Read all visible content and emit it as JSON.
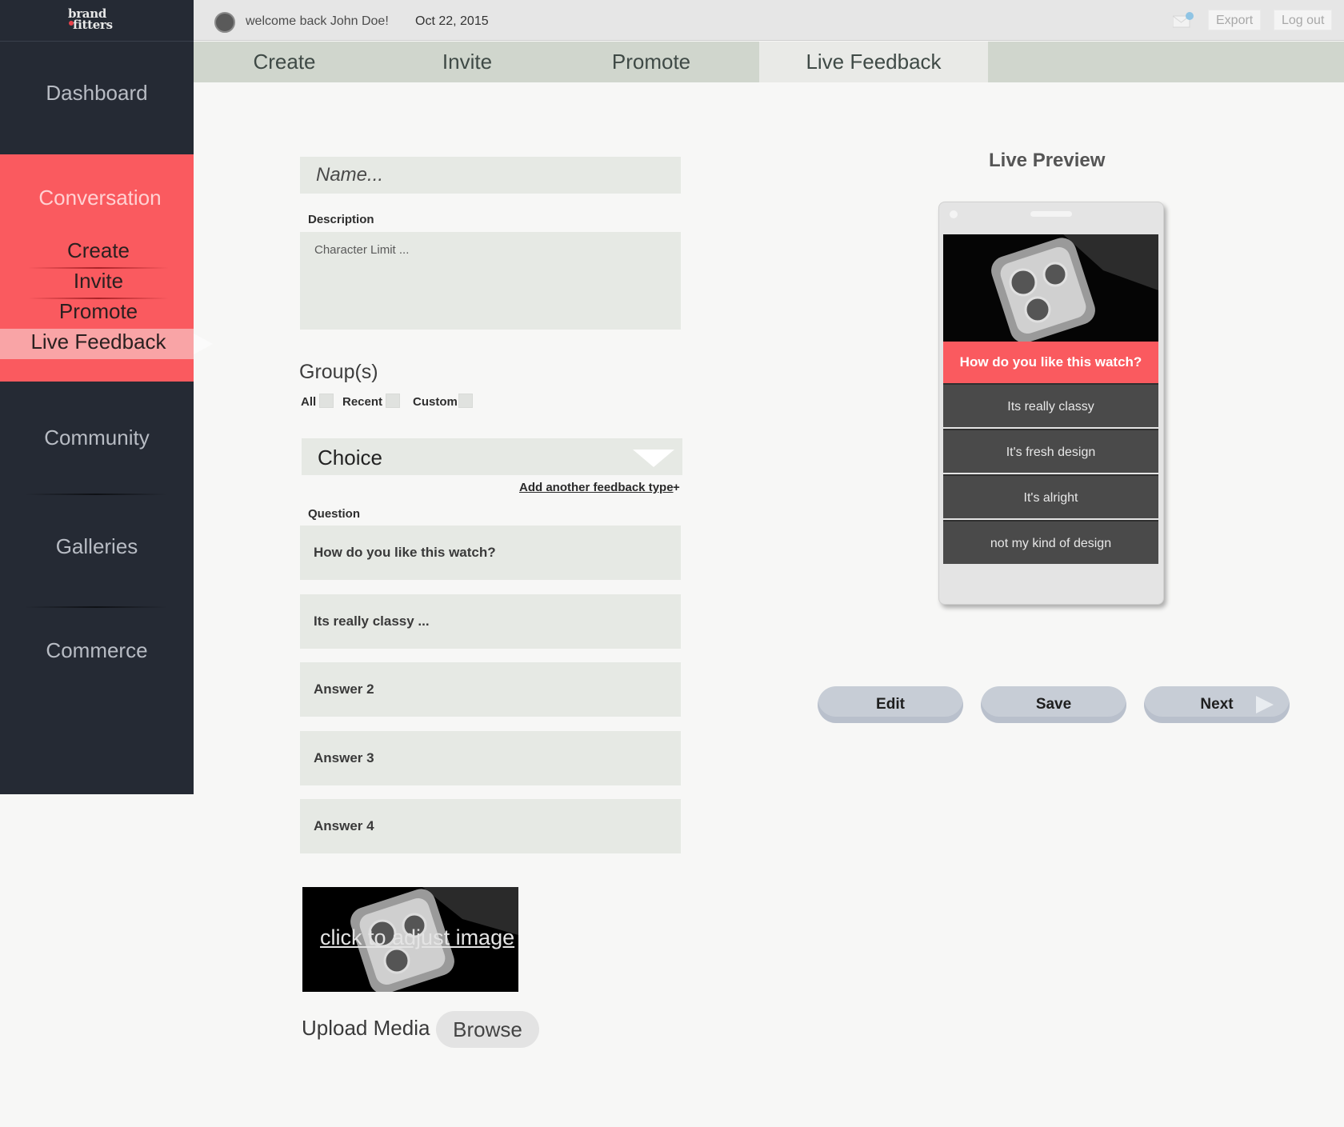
{
  "brand": {
    "line1": "brand",
    "line2": "fitters"
  },
  "sidebar": {
    "dashboard": "Dashboard",
    "conversation": "Conversation",
    "sub_items": [
      "Create",
      "Invite",
      "Promote",
      "Live Feedback"
    ],
    "community": "Community",
    "galleries": "Galleries",
    "commerce": "Commerce"
  },
  "topbar": {
    "welcome": "welcome back John Doe!",
    "date": "Oct 22, 2015",
    "export": "Export",
    "logout": "Log out"
  },
  "tabs": [
    "Create",
    "Invite",
    "Promote",
    "Live Feedback"
  ],
  "form": {
    "name_placeholder": "Name...",
    "description_label": "Description",
    "description_placeholder": "Character Limit ...",
    "groups_title": "Group(s)",
    "groups": [
      "All",
      "Recent",
      "Custom"
    ],
    "feedback_type": "Choice",
    "add_feedback_link": "Add another feedback type",
    "add_feedback_plus": "+",
    "question_label": "Question",
    "question": "How do you like this watch?",
    "answers": [
      "Its really classy ...",
      "Answer 2",
      "Answer 3",
      "Answer 4"
    ],
    "image_link": "click to adjust image",
    "upload_label": "Upload Media",
    "browse": "Browse"
  },
  "preview": {
    "title": "Live Preview",
    "question": "How do you like this watch?",
    "options": [
      "Its really classy",
      "It's fresh design",
      "It's alright",
      "not my kind of design"
    ]
  },
  "actions": {
    "edit": "Edit",
    "save": "Save",
    "next": "Next"
  },
  "colors": {
    "accent": "#fa5a5f",
    "sidebar": "#252a34",
    "tab_bar": "#d0d6cd"
  }
}
